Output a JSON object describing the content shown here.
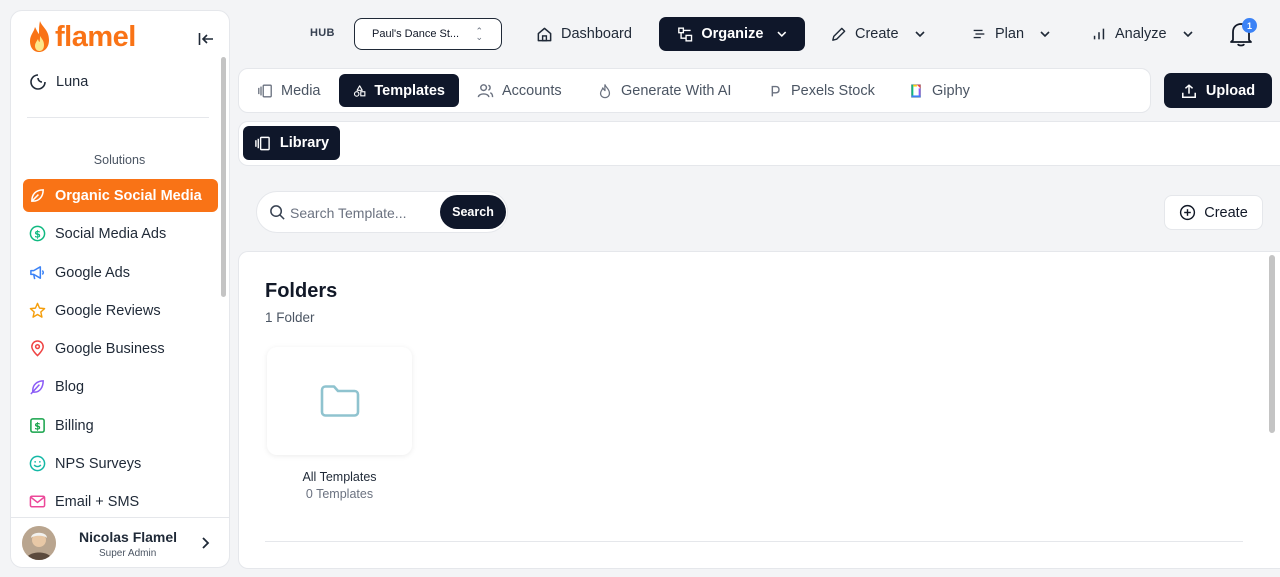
{
  "sidebar": {
    "logo_text": "flamel",
    "top_item": {
      "label": "Luna",
      "icon": "moon-cycle-icon"
    },
    "section_heading": "Solutions",
    "items": [
      {
        "label": "Organic Social Media",
        "icon": "leaf-icon",
        "active": true
      },
      {
        "label": "Social Media Ads",
        "icon": "dollar-circle-icon"
      },
      {
        "label": "Google Ads",
        "icon": "megaphone-icon"
      },
      {
        "label": "Google Reviews",
        "icon": "star-icon"
      },
      {
        "label": "Google Business",
        "icon": "map-pin-icon"
      },
      {
        "label": "Blog",
        "icon": "feather-icon"
      },
      {
        "label": "Billing",
        "icon": "dollar-square-icon"
      },
      {
        "label": "NPS Surveys",
        "icon": "smile-icon"
      },
      {
        "label": "Email + SMS",
        "icon": "mail-icon"
      }
    ],
    "profile": {
      "name": "Nicolas Flamel",
      "role": "Super Admin"
    }
  },
  "topbar": {
    "hub_label": "HUB",
    "hub_value": "Paul's Dance St...",
    "nav": [
      {
        "label": "Dashboard",
        "icon": "home-icon"
      },
      {
        "label": "Organize",
        "icon": "organize-icon",
        "active": true
      },
      {
        "label": "Create",
        "icon": "pen-icon"
      },
      {
        "label": "Plan",
        "icon": "list-icon"
      },
      {
        "label": "Analyze",
        "icon": "bar-chart-icon"
      }
    ],
    "notification_count": "1"
  },
  "tabs": [
    {
      "label": "Media",
      "icon": "media-icon"
    },
    {
      "label": "Templates",
      "icon": "shapes-icon",
      "active": true
    },
    {
      "label": "Accounts",
      "icon": "users-icon"
    },
    {
      "label": "Generate With AI",
      "icon": "flame-icon"
    },
    {
      "label": "Pexels Stock",
      "icon": "pexels-icon"
    },
    {
      "label": "Giphy",
      "icon": "giphy-icon"
    }
  ],
  "upload_label": "Upload",
  "subtab": {
    "label": "Library"
  },
  "search": {
    "placeholder": "Search Template...",
    "button_label": "Search"
  },
  "create_label": "Create",
  "folders": {
    "title": "Folders",
    "count_label": "1 Folder",
    "items": [
      {
        "name": "All Templates",
        "count": "0 Templates"
      }
    ]
  },
  "colors": {
    "accent": "#f97316",
    "dark": "#0f172a",
    "folder_icon": "#8fc3cf",
    "badge": "#3b82f6"
  }
}
